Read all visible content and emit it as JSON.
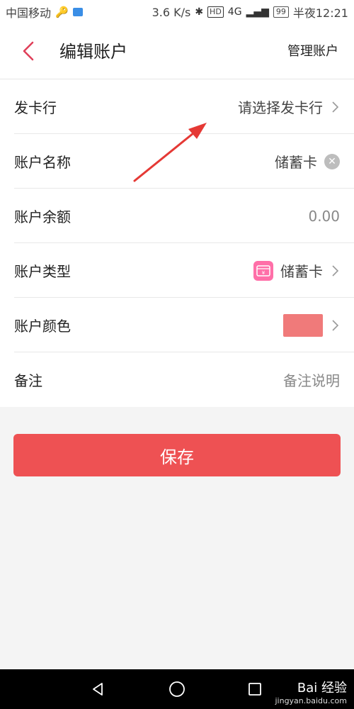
{
  "status_bar": {
    "carrier": "中国移动",
    "speed": "3.6 K/s",
    "signal_badge": "HD",
    "network": "4G",
    "battery": "99",
    "time": "半夜12:21"
  },
  "header": {
    "title": "编辑账户",
    "manage_label": "管理账户"
  },
  "form": {
    "issuer": {
      "label": "发卡行",
      "value": "请选择发卡行"
    },
    "name": {
      "label": "账户名称",
      "value": "储蓄卡"
    },
    "balance": {
      "label": "账户余额",
      "value": "0.00"
    },
    "type": {
      "label": "账户类型",
      "value": "储蓄卡"
    },
    "color": {
      "label": "账户颜色",
      "value_color": "#f07a7a"
    },
    "note": {
      "label": "备注",
      "placeholder": "备注说明"
    }
  },
  "save_label": "保存",
  "watermark": {
    "main": "Bai 经验",
    "sub": "jingyan.baidu.com"
  },
  "colors": {
    "accent": "#ee5153",
    "annotation": "#e53935"
  }
}
